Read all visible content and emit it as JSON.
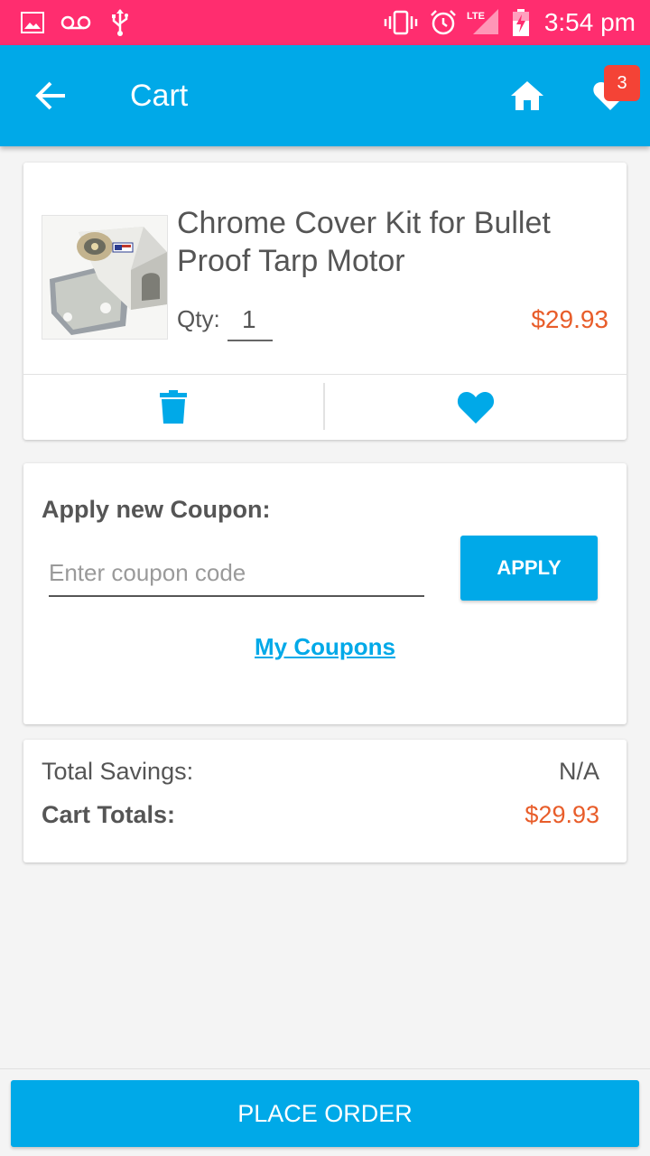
{
  "status_bar": {
    "time": "3:54 pm",
    "icons": [
      "image-icon",
      "voicemail-icon",
      "usb-icon",
      "vibrate-icon",
      "alarm-icon",
      "lte-signal-icon",
      "battery-charging-icon"
    ],
    "lte_label": "LTE",
    "color": "#ff2d6f"
  },
  "app_bar": {
    "title": "Cart",
    "wishlist_badge_count": "3",
    "color": "#00a9e8"
  },
  "cart_item": {
    "title": "Chrome Cover Kit for Bullet Proof Tarp Motor",
    "qty_label": "Qty:",
    "qty_value": "1",
    "price": "$29.93",
    "image_name": "product-image"
  },
  "coupon": {
    "heading": "Apply new Coupon:",
    "input_value": "",
    "input_placeholder": "Enter coupon code",
    "apply_label": "APPLY",
    "my_coupons_label": "My Coupons"
  },
  "totals": {
    "savings_label": "Total Savings:",
    "savings_value": "N/A",
    "cart_totals_label": "Cart Totals:",
    "cart_totals_value": "$29.93"
  },
  "footer": {
    "place_order_label": "PLACE ORDER"
  },
  "colors": {
    "accent": "#00a9e8",
    "price": "#e85d2a",
    "badge": "#f44336"
  }
}
